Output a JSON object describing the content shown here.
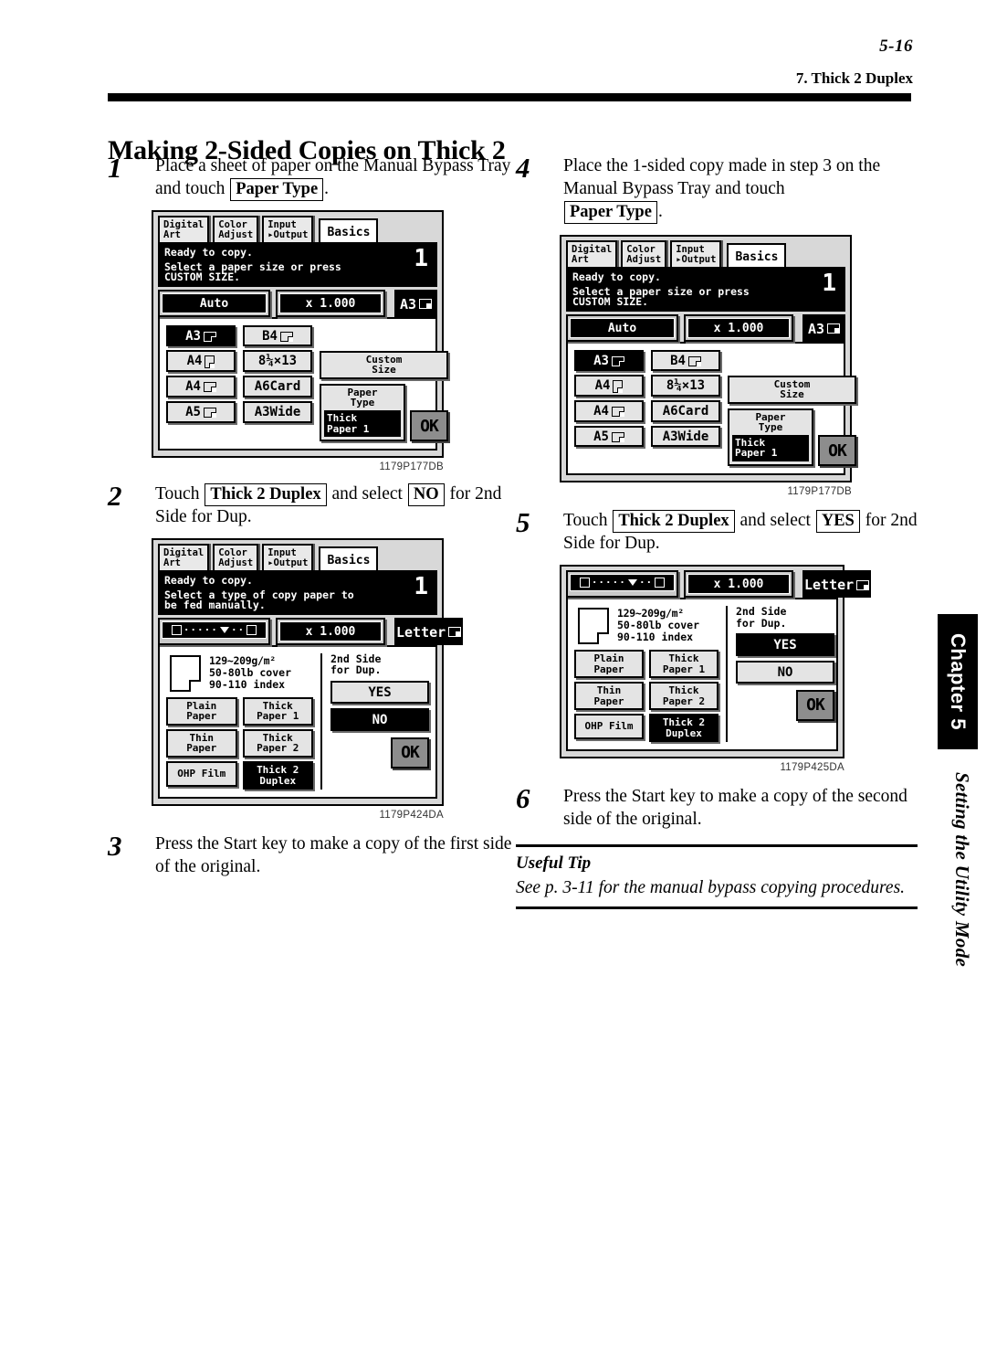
{
  "header": {
    "page_number": "5-16",
    "section_title": "7. Thick 2 Duplex"
  },
  "title": "Making 2-Sided Copies on Thick 2",
  "side_tab": {
    "chapter": "Chapter 5",
    "mode": "Setting the Utility Mode"
  },
  "steps": [
    {
      "num": "1",
      "text_before": "Place a sheet of paper on the Manual Bypass Tray and touch ",
      "key": "Paper Type",
      "text_after": "."
    },
    {
      "num": "2",
      "text_before": "Touch ",
      "key": "Thick 2 Duplex",
      "text_mid": " and select ",
      "key2": "NO",
      "text_after": " for 2nd Side for Dup."
    },
    {
      "num": "3",
      "text_before": "Press the Start key to make a copy of the first side of the original."
    },
    {
      "num": "4",
      "text_before": "Place the 1-sided copy made in step 3 on the Manual Bypass Tray and touch ",
      "key": "Paper Type",
      "text_after": "."
    },
    {
      "num": "5",
      "text_before": "Touch ",
      "key": "Thick 2 Duplex",
      "text_mid": " and select ",
      "key2": "YES",
      "text_after": " for 2nd Side for Dup."
    },
    {
      "num": "6",
      "text_before": "Press the Start key to make a copy of the second side of the original."
    }
  ],
  "useful_tip": {
    "heading": "Useful Tip",
    "text": "See p. 3-11 for the manual bypass copying procedures."
  },
  "figures": {
    "fig1_code": "1179P177DB",
    "fig2_code": "1179P424DA",
    "fig3_code": "1179P177DB",
    "fig4_code": "1179P425DA"
  },
  "lcd_common": {
    "tabs": [
      {
        "line1": "Digital",
        "line2": "Art"
      },
      {
        "line1": "Color",
        "line2": "Adjust"
      },
      {
        "line1": "Input",
        "line2": "▸Output"
      }
    ],
    "tab_active": "Basics",
    "copy_count": "1",
    "ok_label": "OK"
  },
  "lcd_size_screen": {
    "status_line1": "Ready to copy.",
    "status_line2": "Select a paper size or press",
    "status_line3": "CUSTOM SIZE.",
    "auto_label": "Auto",
    "zoom_label": "x 1.000",
    "paper_label": "A3",
    "sizes": [
      {
        "label": "A3",
        "glyph": "land",
        "selected": true
      },
      {
        "label": "B4",
        "glyph": "land",
        "selected": false
      },
      {
        "label": "A4",
        "glyph": "port",
        "selected": false
      },
      {
        "label": "8¼×13",
        "glyph": "none",
        "selected": false
      },
      {
        "label": "A4",
        "glyph": "land",
        "selected": false
      },
      {
        "label": "A6Card",
        "glyph": "none",
        "selected": false
      },
      {
        "label": "A5",
        "glyph": "land",
        "selected": false
      },
      {
        "label": "A3Wide",
        "glyph": "none",
        "selected": false
      }
    ],
    "custom_size_l1": "Custom",
    "custom_size_l2": "Size",
    "paper_type_l1": "Paper",
    "paper_type_l2": "Type",
    "paper_type_val_l1": "Thick",
    "paper_type_val_l2": "Paper 1"
  },
  "lcd_type_screen": {
    "status_line1": "Ready to copy.",
    "status_line2": "Select a type of copy paper to",
    "status_line3": "be fed manually.",
    "zoom_label": "x 1.000",
    "paper_label": "Letter",
    "weight_l1": "129~209g/m²",
    "weight_l2": "50-80lb cover",
    "weight_l3": "90-110 index",
    "types": [
      {
        "l1": "Plain",
        "l2": "Paper",
        "selected": false
      },
      {
        "l1": "Thick",
        "l2": "Paper 1",
        "selected": false
      },
      {
        "l1": "Thin",
        "l2": "Paper",
        "selected": false
      },
      {
        "l1": "Thick",
        "l2": "Paper 2",
        "selected": false
      },
      {
        "l1": "OHP Film",
        "l2": "",
        "selected": false
      },
      {
        "l1": "Thick 2",
        "l2": "Duplex",
        "selected": true
      }
    ],
    "dup_label_l1": "2nd Side",
    "dup_label_l2": "for Dup.",
    "yes_label": "YES",
    "no_label": "NO",
    "no_selected_step2": true,
    "yes_selected_step5": true
  }
}
